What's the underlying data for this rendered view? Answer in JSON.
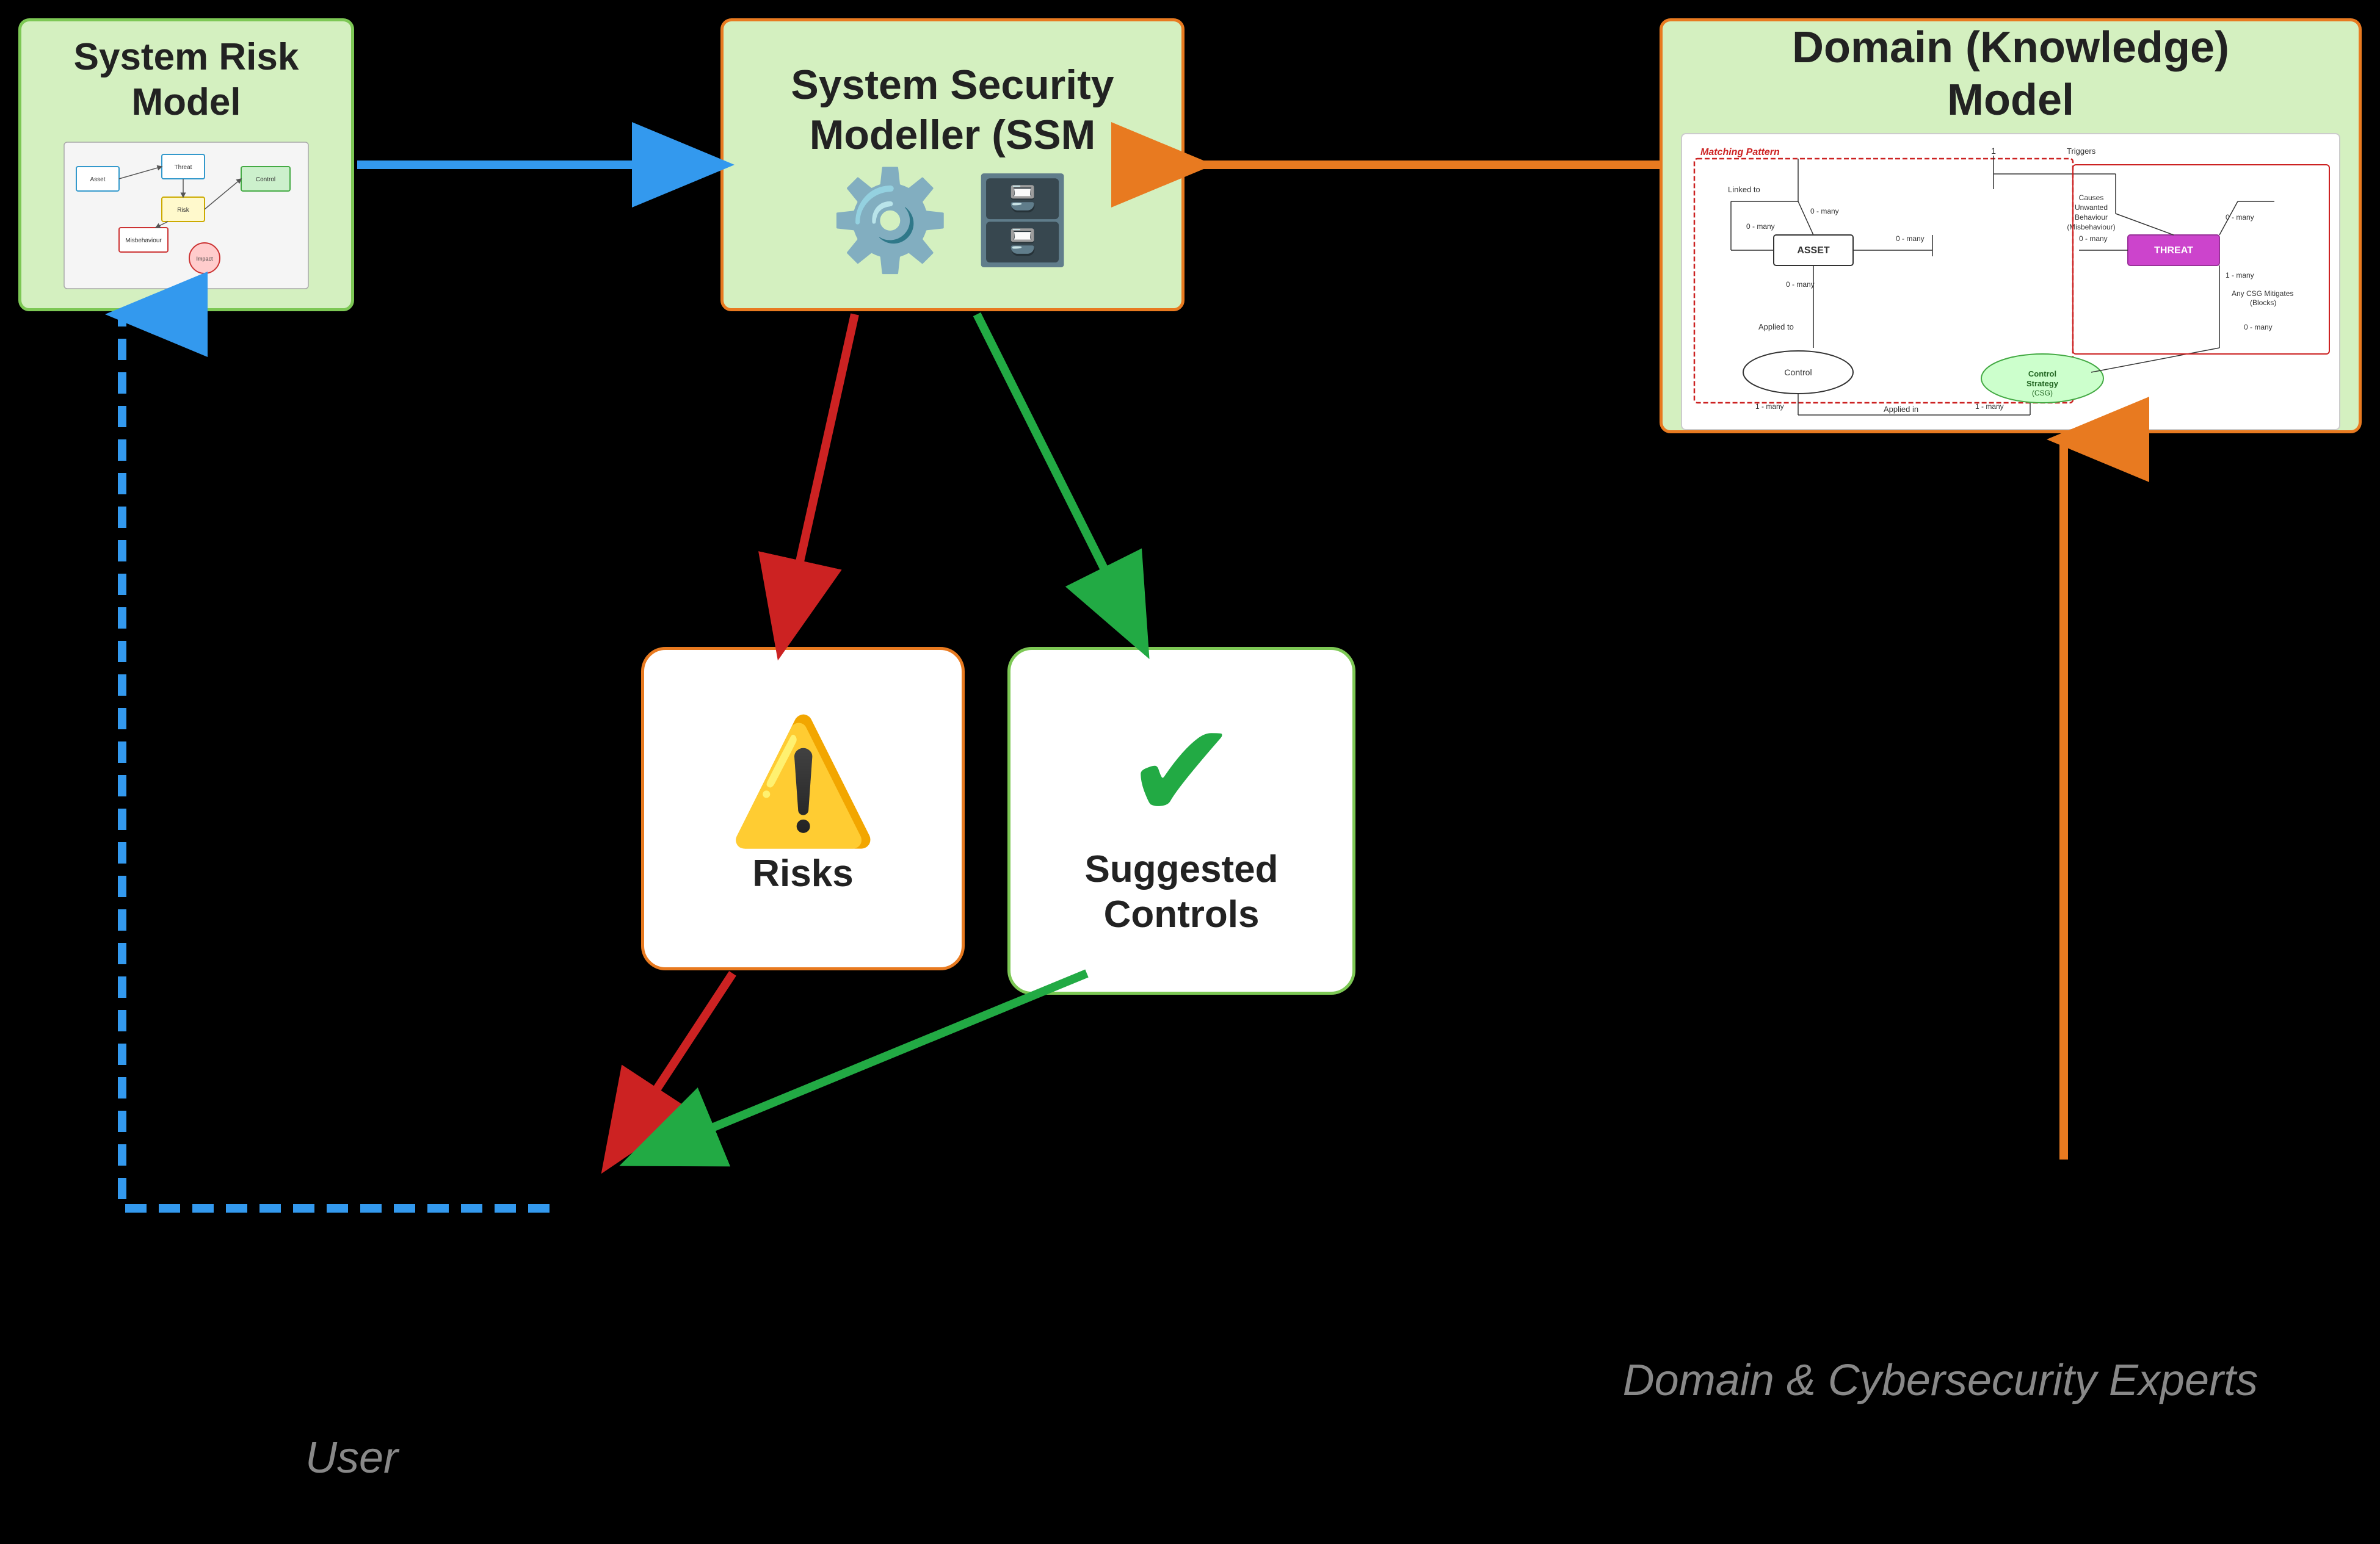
{
  "system_risk_model": {
    "title": "System Risk\nModel"
  },
  "ssm": {
    "title": "System Security\nModeller (SSM"
  },
  "domain": {
    "title": "Domain (Knowledge)\nModel"
  },
  "risks": {
    "label": "Risks"
  },
  "controls": {
    "label": "Suggested\nControls"
  },
  "user_label": "User",
  "domain_experts_label": "Domain &\nCybersecurity\nExperts",
  "domain_diagram": {
    "matching_pattern_label": "Matching Pattern",
    "linked_to": "Linked to",
    "asset": "ASSET",
    "threat": "THREAT",
    "control": "Control",
    "control_strategy": "Control Strategy\n(CSG)",
    "triggers": "Triggers",
    "causes_unwanted": "Causes\nUnwanted\nBehaviour\n(Misbehaviour)",
    "applied_to": "Applied to",
    "applied_in": "Applied in",
    "any_csg": "Any CSG Mitigates\n(Blocks)",
    "zero_many": "0 - many",
    "one_many": "1 - many",
    "one": "1"
  }
}
